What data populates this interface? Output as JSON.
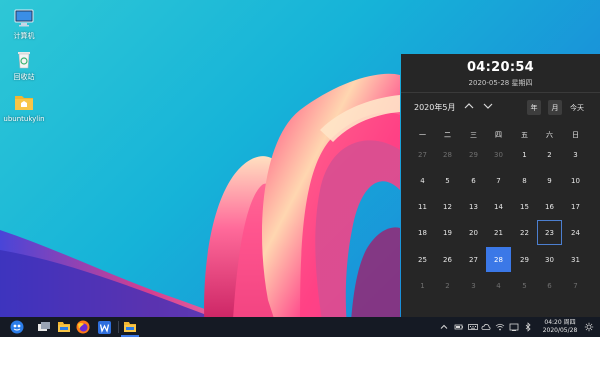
{
  "desktop": {
    "icons": [
      {
        "label": "计算机",
        "icon": "computer-icon"
      },
      {
        "label": "回收站",
        "icon": "trash-icon"
      },
      {
        "label": "ubuntukylin",
        "icon": "home-folder-icon"
      }
    ]
  },
  "calendar": {
    "time": "04:20:54",
    "date": "2020-05-28 星期四",
    "month_label": "2020年5月",
    "year_button": "年",
    "month_button": "月",
    "today_button": "今天",
    "weekdays": [
      "一",
      "二",
      "三",
      "四",
      "五",
      "六",
      "日"
    ],
    "days": [
      "27",
      "28",
      "29",
      "30",
      "1",
      "2",
      "3",
      "4",
      "5",
      "6",
      "7",
      "8",
      "9",
      "10",
      "11",
      "12",
      "13",
      "14",
      "15",
      "16",
      "17",
      "18",
      "19",
      "20",
      "21",
      "22",
      "23",
      "24",
      "25",
      "26",
      "27",
      "28",
      "29",
      "30",
      "31",
      "1",
      "2",
      "3",
      "4",
      "5",
      "6",
      "7"
    ],
    "current_month_range": [
      4,
      34
    ],
    "selected_day": "28",
    "today_day": "23",
    "colors": {
      "panel": "#262626",
      "selected": "#3b78e7",
      "today_border": "#4c7fd0"
    }
  },
  "taskbar": {
    "apps": [
      "start-menu-icon",
      "show-desktop-icon",
      "file-manager-icon",
      "firefox-icon",
      "wps-writer-icon",
      "file-manager-icon"
    ],
    "tray": [
      "chevron-up-icon",
      "battery-icon",
      "keyboard-icon",
      "cloud-icon",
      "wifi-icon",
      "volume-icon",
      "notification-icon",
      "bluetooth-icon"
    ],
    "clock_time": "04:20 周四",
    "clock_date": "2020/05/28"
  }
}
